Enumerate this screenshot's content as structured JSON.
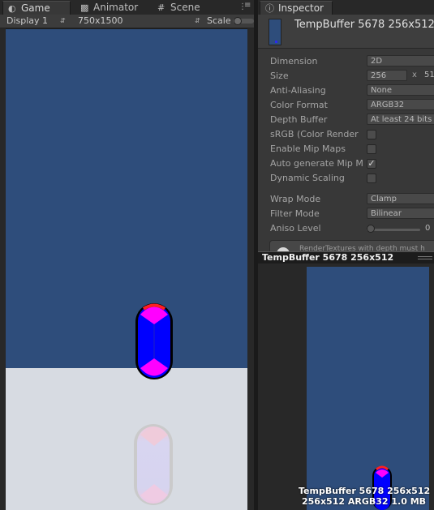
{
  "tabs_left": [
    {
      "label": "Game",
      "icon": "game-icon",
      "active": true
    },
    {
      "label": "Animator",
      "icon": "animator-icon",
      "active": false
    },
    {
      "label": "Scene",
      "icon": "scene-icon",
      "active": false
    }
  ],
  "tab_inspector": {
    "label": "Inspector",
    "icon": "info-icon"
  },
  "game_toolbar": {
    "display": "Display 1",
    "resolution": "750x1500",
    "scale_label": "Scale"
  },
  "inspector": {
    "title": "TempBuffer 5678 256x512",
    "dimension": {
      "label": "Dimension",
      "value": "2D"
    },
    "size": {
      "label": "Size",
      "width": "256",
      "separator": "x",
      "height": "51"
    },
    "anti_aliasing": {
      "label": "Anti-Aliasing",
      "value": "None"
    },
    "color_format": {
      "label": "Color Format",
      "value": "ARGB32"
    },
    "depth_buffer": {
      "label": "Depth Buffer",
      "value": "At least 24 bits"
    },
    "srgb": {
      "label": "sRGB (Color Render",
      "checked": false
    },
    "mipmaps": {
      "label": "Enable Mip Maps",
      "checked": false
    },
    "auto_mip": {
      "label": "Auto generate Mip M",
      "checked": true,
      "check_glyph": "✓"
    },
    "dynamic_scaling": {
      "label": "Dynamic Scaling",
      "checked": false
    },
    "wrap_mode": {
      "label": "Wrap Mode",
      "value": "Clamp"
    },
    "filter_mode": {
      "label": "Filter Mode",
      "value": "Bilinear"
    },
    "aniso_level": {
      "label": "Aniso Level",
      "value": "0"
    },
    "info_text": "RenderTextures with depth must h"
  },
  "preview": {
    "title": "TempBuffer 5678 256x512",
    "caption_line1": "TempBuffer 5678 256x512",
    "caption_line2": "256x512  ARGB32  1.0 MB"
  },
  "colors": {
    "sky": "#2e4d7b",
    "ground": "#d7dbe2",
    "capsule_body": "#0000ff",
    "capsule_caps": "#ff00ff",
    "capsule_outline": "#000000"
  }
}
